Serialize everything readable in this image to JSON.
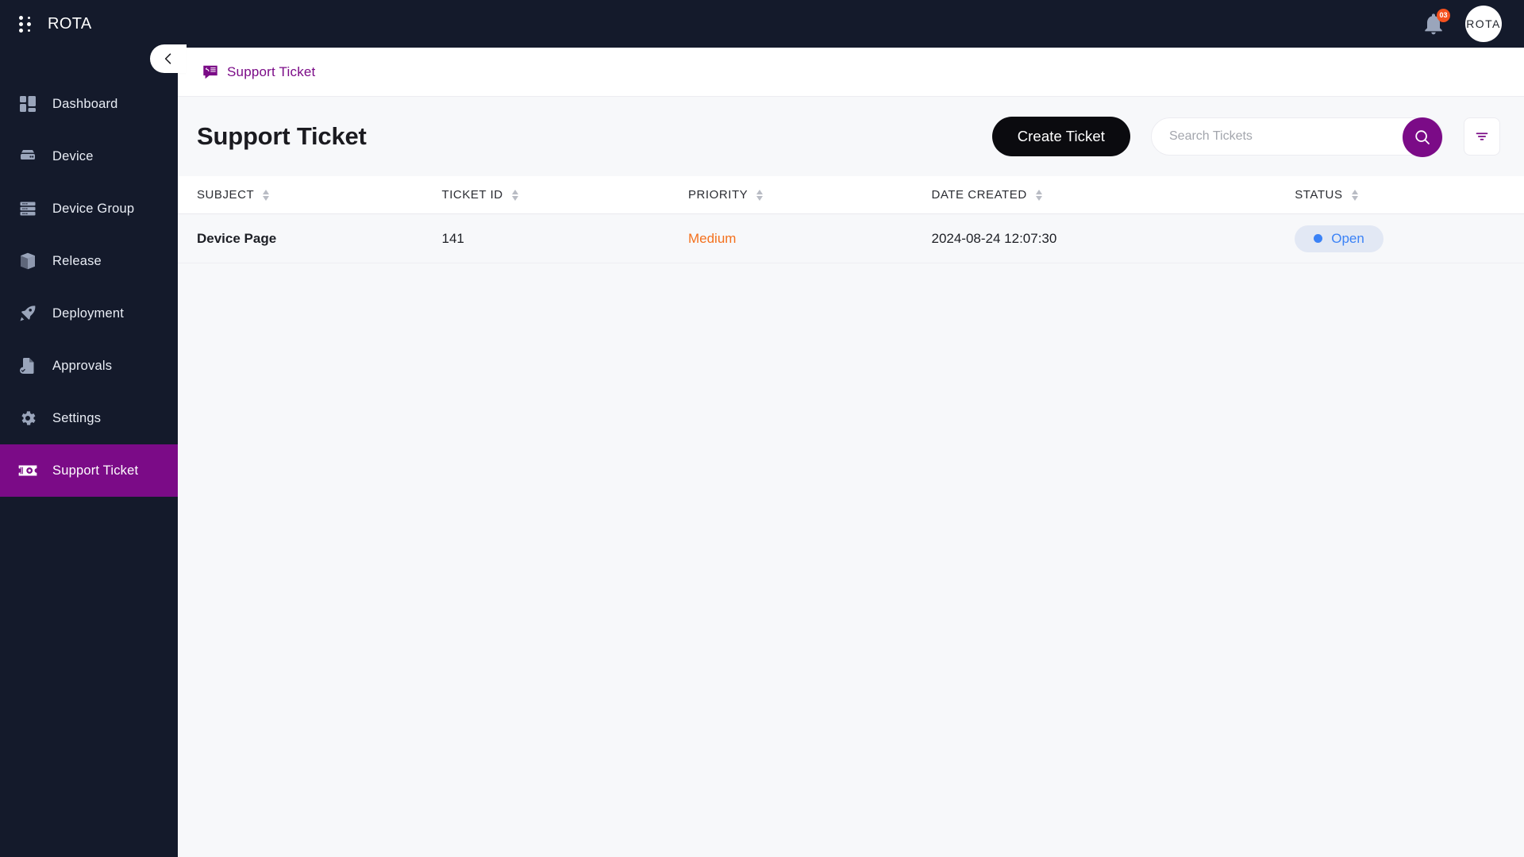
{
  "brand": {
    "name": "ROTA",
    "logo_icon": "dots-grid-icon"
  },
  "topbar": {
    "notification_icon": "bell-icon",
    "notification_count": "03",
    "avatar_label": "ROTA"
  },
  "sidebar": {
    "collapse_icon": "chevron-left-icon",
    "items": [
      {
        "label": "Dashboard",
        "icon": "dashboard-icon",
        "active": false
      },
      {
        "label": "Device",
        "icon": "server-icon",
        "active": false
      },
      {
        "label": "Device Group",
        "icon": "server-rack-icon",
        "active": false
      },
      {
        "label": "Release",
        "icon": "box-icon",
        "active": false
      },
      {
        "label": "Deployment",
        "icon": "rocket-icon",
        "active": false
      },
      {
        "label": "Approvals",
        "icon": "document-check-icon",
        "active": false
      },
      {
        "label": "Settings",
        "icon": "gear-icon",
        "active": false
      },
      {
        "label": "Support Ticket",
        "icon": "ticket-icon",
        "active": true
      }
    ]
  },
  "breadcrumb": {
    "icon": "support-ticket-icon",
    "label": "Support Ticket"
  },
  "page": {
    "title": "Support Ticket",
    "create_button": "Create Ticket",
    "search_placeholder": "Search Tickets",
    "search_value": "",
    "search_icon": "search-icon",
    "filter_icon": "filter-icon"
  },
  "table": {
    "columns": [
      {
        "label": "SUBJECT",
        "sort_icon": "sort-icon"
      },
      {
        "label": "TICKET ID",
        "sort_icon": "sort-icon"
      },
      {
        "label": "PRIORITY",
        "sort_icon": "sort-icon"
      },
      {
        "label": "DATE CREATED",
        "sort_icon": "sort-icon"
      },
      {
        "label": "STATUS",
        "sort_icon": "sort-icon"
      }
    ],
    "rows": [
      {
        "subject": "Device Page",
        "ticket_id": "141",
        "priority": "Medium",
        "date_created": "2024-08-24 12:07:30",
        "status": "Open"
      }
    ]
  },
  "colors": {
    "brand_purple": "#7b0b87",
    "sidebar_bg": "#141a2b",
    "priority_medium": "#f4711e",
    "status_open": "#3b82f6",
    "status_open_bg": "#e2e8f4",
    "create_button_bg": "#0b0b0f"
  }
}
